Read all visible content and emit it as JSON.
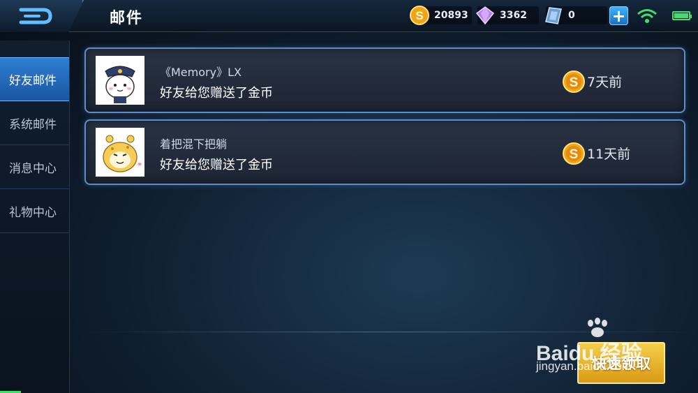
{
  "header": {
    "title": "邮件",
    "gold": "20893",
    "diamonds": "3362",
    "vouchers": "0",
    "plus_label": "+"
  },
  "sidebar": {
    "items": [
      {
        "label": "好友邮件",
        "active": true
      },
      {
        "label": "系统邮件",
        "active": false
      },
      {
        "label": "消息中心",
        "active": false
      },
      {
        "label": "礼物中心",
        "active": false
      }
    ]
  },
  "mails": [
    {
      "sender": "《Memory》LX",
      "message": "好友给您赠送了金币",
      "age": "7天前",
      "reward_icon": "gold-coin-icon"
    },
    {
      "sender": "着把混下把躺",
      "message": "好友给您赠送了金币",
      "age": "11天前",
      "reward_icon": "gold-coin-icon"
    }
  ],
  "actions": {
    "quick_claim": "快速领取"
  },
  "watermark": {
    "line1": "Baidu 经验",
    "line2": "jingyan.baidu.com"
  },
  "colors": {
    "accent_blue": "#2f7fd2",
    "gold_button": "#e8b42a",
    "card_border": "#5c8fc8",
    "status_green": "#3ee06a"
  }
}
